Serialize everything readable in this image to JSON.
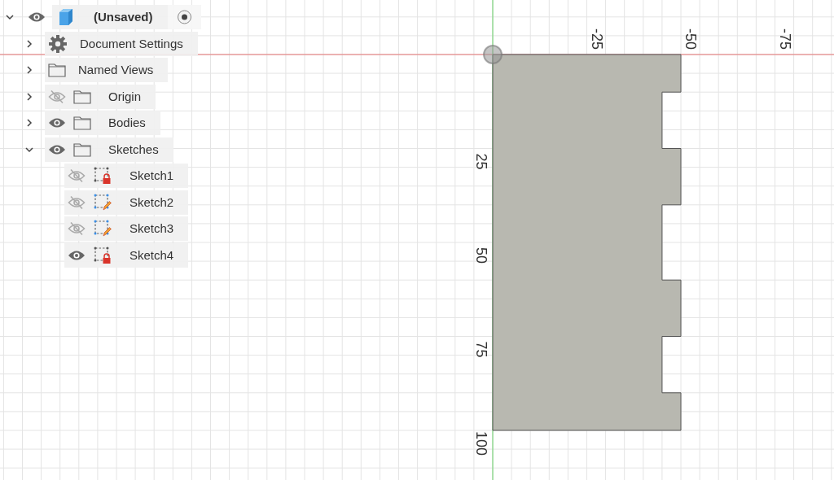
{
  "browser": {
    "root": {
      "label": "(Unsaved)",
      "expanded": true,
      "visible": true,
      "active": true
    },
    "items": [
      {
        "label": "Document Settings",
        "kind": "settings",
        "expanded": false
      },
      {
        "label": "Named Views",
        "kind": "folder",
        "expanded": false
      },
      {
        "label": "Origin",
        "kind": "folder",
        "expanded": false,
        "visible": false
      },
      {
        "label": "Bodies",
        "kind": "folder",
        "expanded": false,
        "visible": true
      },
      {
        "label": "Sketches",
        "kind": "folder",
        "expanded": true,
        "visible": true,
        "children": [
          {
            "label": "Sketch1",
            "kind": "sketch",
            "visible": false,
            "locked": true
          },
          {
            "label": "Sketch2",
            "kind": "sketch",
            "visible": false,
            "locked": false
          },
          {
            "label": "Sketch3",
            "kind": "sketch",
            "visible": false,
            "locked": false
          },
          {
            "label": "Sketch4",
            "kind": "sketch",
            "visible": true,
            "locked": true
          }
        ]
      }
    ]
  },
  "canvas": {
    "horizontal_labels": [
      "-25",
      "-50",
      "-75"
    ],
    "vertical_labels": [
      "25",
      "50",
      "75",
      "100"
    ]
  }
}
